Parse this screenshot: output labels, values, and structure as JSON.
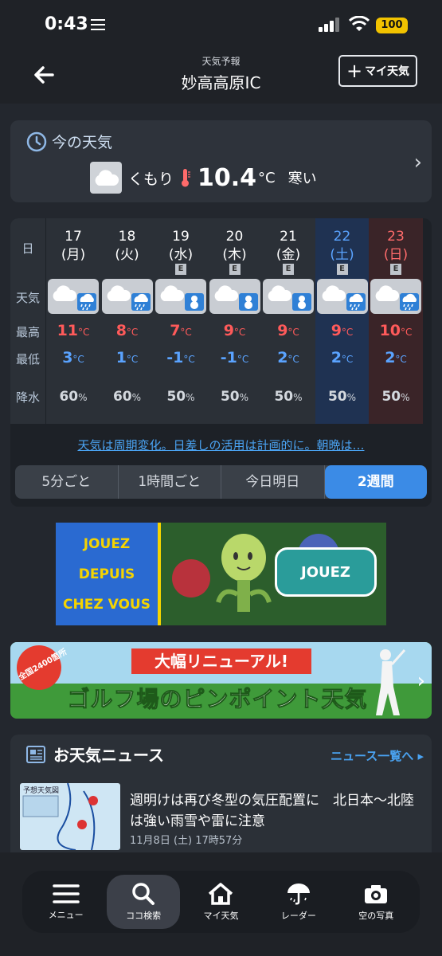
{
  "status": {
    "time": "0:43",
    "battery": "100"
  },
  "header": {
    "subtitle": "天気予報",
    "title": "妙高高原IC",
    "my_weather_btn": "マイ天気"
  },
  "now": {
    "title": "今の天気",
    "condition": "くもり",
    "temp": "10.4",
    "unit": "°C",
    "feel": "寒い"
  },
  "forecast": {
    "labels": {
      "day": "日",
      "weather": "天気",
      "high": "最高",
      "low": "最低",
      "precip": "降水"
    },
    "days": [
      {
        "date": "17",
        "dow": "(月)",
        "e": "",
        "high": "11",
        "low": "3",
        "precip": "60",
        "sub": "rain",
        "theme": "normal"
      },
      {
        "date": "18",
        "dow": "(火)",
        "e": "",
        "high": "8",
        "low": "1",
        "precip": "60",
        "sub": "rain",
        "theme": "normal"
      },
      {
        "date": "19",
        "dow": "(水)",
        "e": "E",
        "high": "7",
        "low": "-1",
        "precip": "50",
        "sub": "snow",
        "theme": "normal"
      },
      {
        "date": "20",
        "dow": "(木)",
        "e": "E",
        "high": "9",
        "low": "-1",
        "precip": "50",
        "sub": "snow",
        "theme": "normal"
      },
      {
        "date": "21",
        "dow": "(金)",
        "e": "E",
        "high": "9",
        "low": "2",
        "precip": "50",
        "sub": "snow",
        "theme": "normal"
      },
      {
        "date": "22",
        "dow": "(土)",
        "e": "E",
        "high": "9",
        "low": "2",
        "precip": "50",
        "sub": "rain",
        "theme": "sat"
      },
      {
        "date": "23",
        "dow": "(日)",
        "e": "E",
        "high": "10",
        "low": "2",
        "precip": "50",
        "sub": "rain",
        "theme": "sun"
      }
    ],
    "temp_unit": "°C",
    "precip_unit": "%",
    "comment_link": "天気は周期変化。日差しの活用は計画的に。朝晩は…",
    "segments": [
      "5分ごと",
      "1時間ごと",
      "今日明日",
      "2週間"
    ],
    "active_segment": 3
  },
  "ad": {
    "left_text_1": "JOUEZ DEPUIS",
    "left_text_2": "CHEZ VOUS",
    "button": "JOUEZ"
  },
  "golf": {
    "tag": "全国2400箇所",
    "renewal": "大幅リニューアル!",
    "main": "ゴルフ場のピンポイント天気"
  },
  "news": {
    "title": "お天気ニュース",
    "all_link": "ニュース一覧へ",
    "thumb_label": "予想天気図",
    "headline": "週明けは再び冬型の気圧配置に　北日本〜北陸は強い雨雪や雷に注意",
    "date": "11月8日 (土) 17時57分"
  },
  "tabs": [
    {
      "label": "メニュー",
      "icon": "menu-icon"
    },
    {
      "label": "ココ検索",
      "icon": "search-icon"
    },
    {
      "label": "マイ天気",
      "icon": "home-icon"
    },
    {
      "label": "レーダー",
      "icon": "umbrella-icon"
    },
    {
      "label": "空の写真",
      "icon": "camera-icon"
    }
  ],
  "active_tab": 1,
  "colors": {
    "accent": "#3b8be6",
    "high": "#ff5a5a",
    "low": "#5aa3ff",
    "sat_bg": "#1f3252",
    "sun_bg": "#3a2428"
  }
}
